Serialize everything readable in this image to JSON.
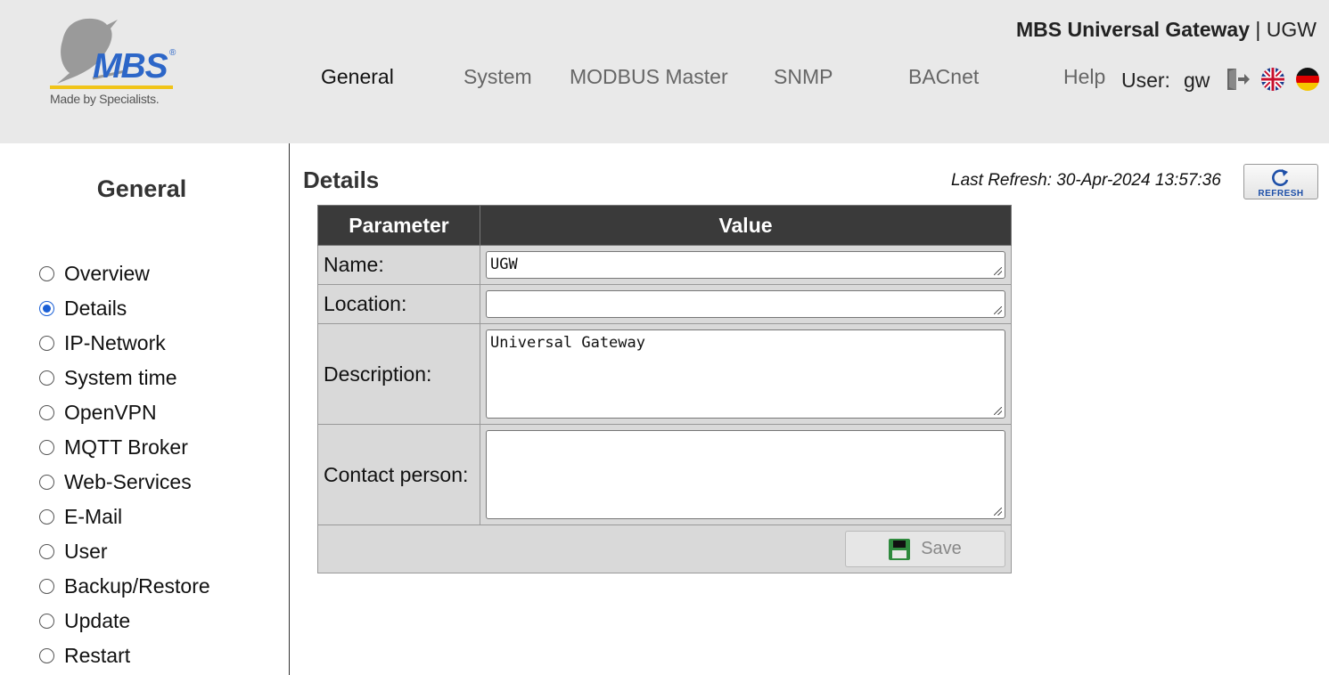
{
  "header": {
    "logo": {
      "brand": "MBS",
      "registered": "®",
      "tagline": "Made by Specialists."
    },
    "product_name": "MBS Universal Gateway",
    "product_separator": " | ",
    "product_short": "UGW",
    "nav": [
      {
        "label": "General",
        "active": true
      },
      {
        "label": "System",
        "active": false
      },
      {
        "label": "MODBUS Master",
        "active": false
      },
      {
        "label": "SNMP",
        "active": false
      },
      {
        "label": "BACnet",
        "active": false
      },
      {
        "label": "Help",
        "active": false
      }
    ],
    "user_label": "User:",
    "user_name": "gw",
    "icons": [
      "logout-icon",
      "flag-uk-icon",
      "flag-de-icon"
    ]
  },
  "sidebar": {
    "title": "General",
    "items": [
      {
        "label": "Overview",
        "checked": false
      },
      {
        "label": "Details",
        "checked": true
      },
      {
        "label": "IP-Network",
        "checked": false
      },
      {
        "label": "System time",
        "checked": false
      },
      {
        "label": "OpenVPN",
        "checked": false
      },
      {
        "label": "MQTT Broker",
        "checked": false
      },
      {
        "label": "Web-Services",
        "checked": false
      },
      {
        "label": "E-Mail",
        "checked": false
      },
      {
        "label": "User",
        "checked": false
      },
      {
        "label": "Backup/Restore",
        "checked": false
      },
      {
        "label": "Update",
        "checked": false
      },
      {
        "label": "Restart",
        "checked": false
      }
    ]
  },
  "main": {
    "title": "Details",
    "last_refresh": "Last Refresh: 30-Apr-2024 13:57:36",
    "refresh_button": "REFRESH",
    "table": {
      "headers": [
        "Parameter",
        "Value"
      ],
      "rows": [
        {
          "label": "Name:",
          "value": "UGW"
        },
        {
          "label": "Location:",
          "value": ""
        },
        {
          "label": "Description:",
          "value": "Universal Gateway"
        },
        {
          "label": "Contact person:",
          "value": ""
        }
      ]
    },
    "save_button": "Save"
  },
  "colors": {
    "header_bg": "#e9e9e9",
    "table_header_bg": "#3a3a3a",
    "table_cell_bg": "#d9d9d9",
    "brand_blue": "#2c66c8",
    "brand_yellow": "#f0c419",
    "radio_checked": "#1a5fd6"
  }
}
